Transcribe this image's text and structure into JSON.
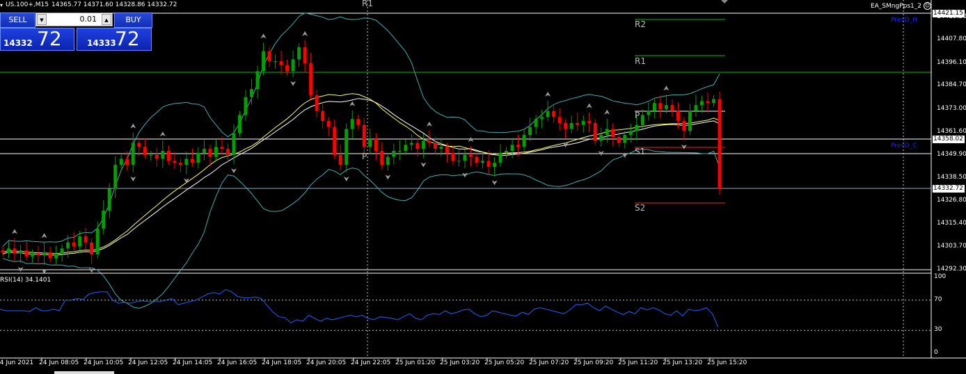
{
  "header": {
    "symbol": "US.100+,M15",
    "ohlc": "14365.77 14371.60 14328.86 14332.72"
  },
  "ea": {
    "name": "EA_SMngPps1_2",
    "icon": "smiley-icon"
  },
  "trade_panel": {
    "sell_label": "SELL",
    "buy_label": "BUY",
    "lot_value": "0.01",
    "sell_price_small": "14332",
    "sell_price_big": "72",
    "buy_price_small": "14333",
    "buy_price_big": "72"
  },
  "price_axis": {
    "ticks": [
      "14419.20",
      "14407.80",
      "14396.10",
      "14384.70",
      "14373.00",
      "14361.60",
      "14349.90",
      "14338.50",
      "14326.80",
      "14315.40",
      "14303.70",
      "14292.30"
    ],
    "tags": [
      {
        "label": "14421.15",
        "bg": "#ffffff"
      },
      {
        "label": "14358.02",
        "bg": "#ffffff"
      },
      {
        "label": "14332.72",
        "bg": "#ffffff"
      }
    ]
  },
  "rsi": {
    "label": "RSI(14) 34.1401",
    "ticks": [
      "100",
      "70",
      "30",
      "0"
    ],
    "values": [
      58,
      56,
      56,
      56,
      56,
      55,
      60,
      56,
      56,
      58,
      56,
      70,
      70,
      72,
      71,
      78,
      80,
      81,
      81,
      70,
      66,
      67,
      66,
      68,
      69,
      68,
      68,
      68,
      70,
      72,
      64,
      66,
      68,
      70,
      74,
      78,
      80,
      78,
      84,
      81,
      75,
      73,
      73,
      74,
      72,
      63,
      54,
      48,
      47,
      40,
      44,
      42,
      50,
      46,
      42,
      46,
      44,
      46,
      48,
      50,
      48,
      50,
      46,
      44,
      48,
      47,
      46,
      44,
      48,
      52,
      46,
      44,
      50,
      52,
      51,
      56,
      52,
      54,
      57,
      58,
      52,
      48,
      50,
      56,
      54,
      52,
      50,
      49,
      54,
      51,
      58,
      60,
      58,
      56,
      54,
      52,
      57,
      64,
      64,
      66,
      60,
      56,
      62,
      58,
      54,
      51,
      55,
      52,
      60,
      57,
      60,
      57,
      52,
      50,
      56,
      49,
      58,
      56,
      57,
      60,
      52,
      34
    ]
  },
  "time_axis": {
    "labels": [
      "24 Jun 2021",
      "24 Jun 08:05",
      "24 Jun 10:05",
      "24 Jun 12:05",
      "24 Jun 14:05",
      "24 Jun 16:05",
      "24 Jun 18:05",
      "24 Jun 20:05",
      "24 Jun 22:05",
      "25 Jun 01:20",
      "25 Jun 03:20",
      "25 Jun 05:20",
      "25 Jun 07:20",
      "25 Jun 09:20",
      "25 Jun 11:20",
      "25 Jun 13:20",
      "25 Jun 15:20"
    ]
  },
  "pivots": {
    "labels": [
      "R1",
      "R2",
      "R1",
      "P",
      "P",
      "S1",
      "S2"
    ],
    "prev_labels": [
      "PrevD_H",
      "PrevD_C"
    ]
  },
  "colors": {
    "bull": "#00a000",
    "bear": "#ff0000",
    "bollinger": "#40b0b0",
    "ma_fast": "#ffff60",
    "rsi_line": "#2060ff",
    "pivot_green": "#00c000",
    "pivot_red": "#ff2020",
    "grid": "#c8c8c8"
  },
  "candles": {
    "closes": [
      14301.0,
      14303.0,
      14300.5,
      14302.0,
      14299.0,
      14300.5,
      14299.5,
      14301.0,
      14298.0,
      14300.0,
      14303.0,
      14306.0,
      14304.0,
      14309.0,
      14306.0,
      14300.0,
      14313.0,
      14322.0,
      14333.0,
      14345.0,
      14348.0,
      14345.0,
      14356.0,
      14354.0,
      14350.0,
      14350.0,
      14348.0,
      14352.0,
      14347.0,
      14346.0,
      14345.0,
      14348.0,
      14346.0,
      14351.0,
      14353.0,
      14349.0,
      14354.0,
      14353.0,
      14350.0,
      14361.0,
      14370.0,
      14379.0,
      14383.0,
      14392.0,
      14402.0,
      14397.0,
      14397.0,
      14395.0,
      14392.0,
      14398.0,
      14404.0,
      14396.0,
      14380.0,
      14372.0,
      14367.0,
      14364.0,
      14350.0,
      14345.0,
      14363.0,
      14368.0,
      14365.0,
      14354.0,
      14358.0,
      14352.0,
      14345.0,
      14349.0,
      14352.0,
      14352.0,
      14355.0,
      14356.0,
      14353.0,
      14357.0,
      14356.0,
      14353.0,
      14354.0,
      14351.0,
      14347.0,
      14347.0,
      14350.0,
      14349.0,
      14346.0,
      14347.0,
      14344.0,
      14346.0,
      14351.0,
      14352.0,
      14355.0,
      14354.0,
      14360.0,
      14364.0,
      14368.0,
      14369.0,
      14372.0,
      14369.0,
      14366.0,
      14363.0,
      14366.0,
      14365.0,
      14367.0,
      14366.0,
      14357.0,
      14360.0,
      14363.0,
      14359.0,
      14356.0,
      14360.0,
      14362.0,
      14365.0,
      14370.0,
      14372.0,
      14376.0,
      14373.0,
      14375.0,
      14372.0,
      14367.0,
      14362.0,
      14372.0,
      14375.0,
      14377.0,
      14376.0,
      14378.0,
      14332.72
    ],
    "open_first": 14302.0
  }
}
